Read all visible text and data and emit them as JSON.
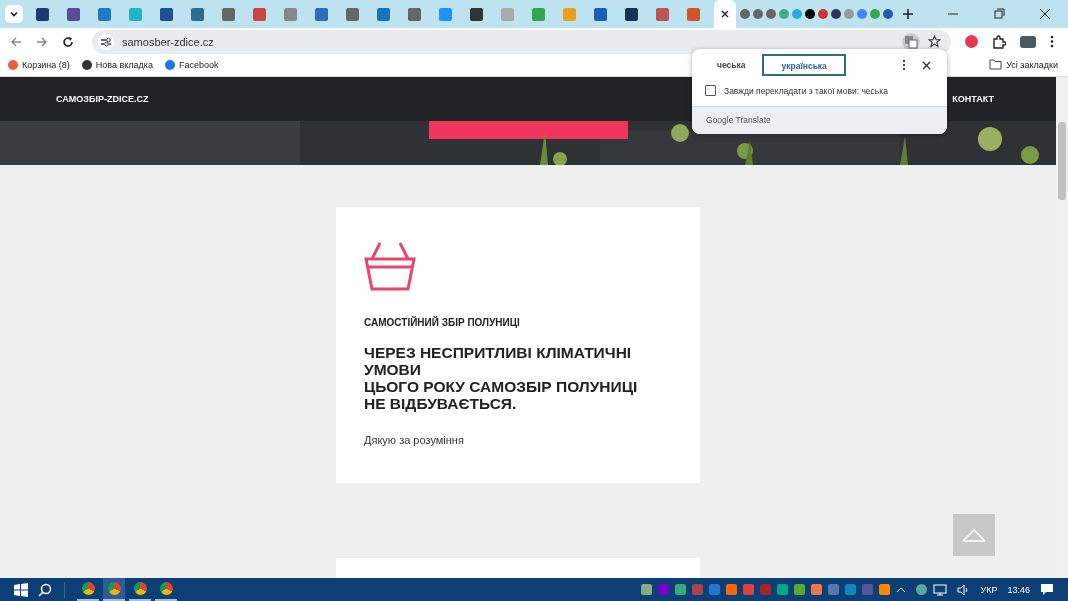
{
  "browser": {
    "url": "samosber-zdice.cz",
    "bookmarks": [
      {
        "label": "Корзина (8)",
        "kind": "store"
      },
      {
        "label": "Нова вкладка",
        "kind": "globe"
      },
      {
        "label": "Facebook",
        "kind": "facebook"
      }
    ],
    "all_bookmarks": "Усі закладки"
  },
  "translate_popup": {
    "tabs": [
      {
        "label": "чеська",
        "selected": false
      },
      {
        "label": "українська",
        "selected": true
      }
    ],
    "always_translate": {
      "label": "Завжди перекладати з такої мови: чеська",
      "checked": false
    },
    "footer": "Google Translate"
  },
  "site": {
    "logo": "САМОЗБІР-ZDICE.CZ",
    "nav": [
      "КОНТАКТ"
    ],
    "card": {
      "subtitle": "САМОСТІЙНИЙ ЗБІР ПОЛУНИЦІ",
      "heading": [
        "ЧЕРЕЗ НЕСПРИТЛИВІ КЛІМАТИЧНІ УМОВИ",
        "ЦЬОГО РОКУ САМОЗБІР ПОЛУНИЦІ НЕ ВІДБУВАЄТЬСЯ."
      ],
      "text": "Дякую за розуміння"
    }
  },
  "taskbar": {
    "language": "УКР",
    "time": "13:46"
  }
}
